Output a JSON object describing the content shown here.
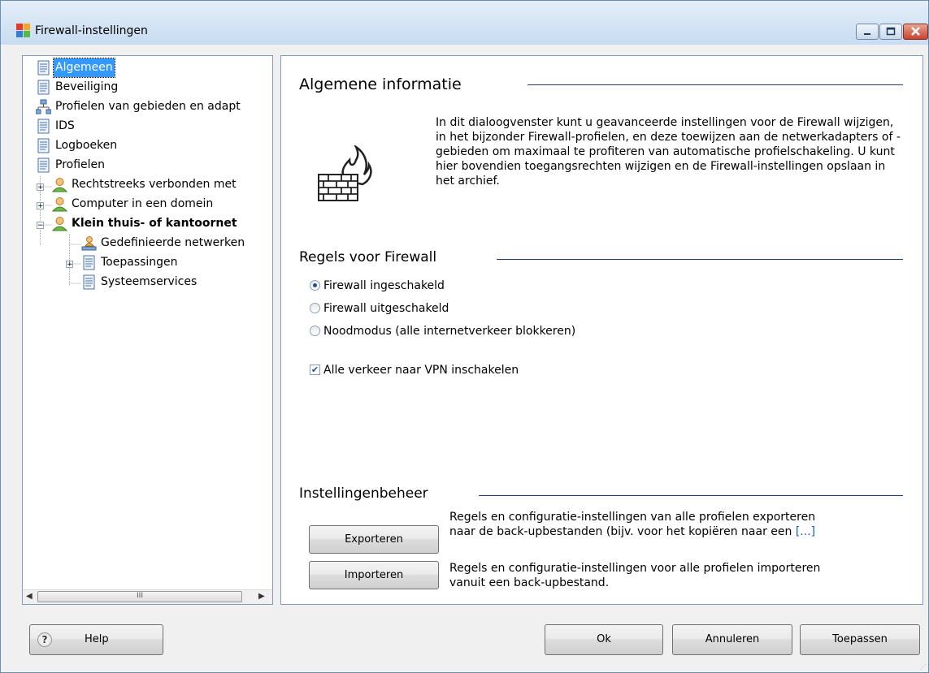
{
  "window": {
    "title": "Firewall-instellingen",
    "icon": "avg-app-icon",
    "controls": [
      "minimize-icon",
      "maximize-icon",
      "close-icon"
    ]
  },
  "tree": {
    "items": [
      {
        "label": "Algemeen",
        "icon": "page-icon",
        "selected": true
      },
      {
        "label": "Beveiliging",
        "icon": "page-icon"
      },
      {
        "label": "Profielen van gebieden en adapt",
        "icon": "network-icon"
      },
      {
        "label": "IDS",
        "icon": "page-icon"
      },
      {
        "label": "Logboeken",
        "icon": "page-icon"
      },
      {
        "label": "Profielen",
        "icon": "page-icon"
      },
      {
        "label": "Rechtstreeks verbonden met",
        "icon": "user-icon",
        "expander": "+"
      },
      {
        "label": "Computer in een domein",
        "icon": "user-icon",
        "expander": "+"
      },
      {
        "label": "Klein thuis- of kantoornet",
        "icon": "user-icon",
        "expander": "−",
        "bold": true
      },
      {
        "label": "Gedefinieerde netwerken",
        "icon": "network-user-icon"
      },
      {
        "label": "Toepassingen",
        "icon": "page-icon",
        "expander": "+"
      },
      {
        "label": "Systeemservices",
        "icon": "page-icon"
      }
    ],
    "scrollbar_thumb_glyph": "III"
  },
  "general": {
    "title": "Algemene informatie",
    "icon": "firewall-icon",
    "text": "In dit dialoogvenster kunt u geavanceerde instellingen voor de Firewall wijzigen, in het bijzonder Firewall-profielen, en deze toewijzen aan de netwerkadapters of -gebieden om maximaal te profiteren van automatische profielschakeling. U kunt hier bovendien toegangsrechten wijzigen en de Firewall-instellingen opslaan in het archief."
  },
  "rules": {
    "title": "Regels voor Firewall",
    "options": [
      {
        "label": "Firewall ingeschakeld",
        "checked": true
      },
      {
        "label": "Firewall uitgeschakeld",
        "checked": false
      },
      {
        "label": "Noodmodus (alle internetverkeer blokkeren)",
        "checked": false
      }
    ],
    "vpn_checkbox": {
      "label": "Alle verkeer naar VPN inschakelen",
      "checked": true
    }
  },
  "management": {
    "title": "Instellingenbeheer",
    "export": {
      "button": "Exporteren",
      "line1": "Regels en configuratie-instellingen van alle profielen exporteren",
      "line2": "naar de back-upbestanden (bijv. voor het kopiëren naar een",
      "more": "[...]"
    },
    "import": {
      "button": "Importeren",
      "line1": "Regels en configuratie-instellingen voor alle profielen importeren",
      "line2": "vanuit een back-upbestand."
    }
  },
  "footer": {
    "help": "Help",
    "ok": "Ok",
    "cancel": "Annuleren",
    "apply": "Toepassen"
  }
}
